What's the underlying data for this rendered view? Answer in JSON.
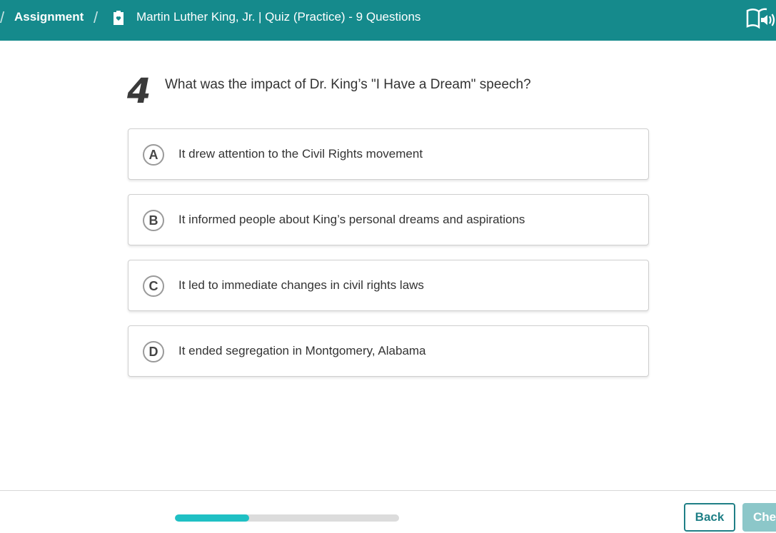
{
  "header": {
    "breadcrumb_root": "Assignment",
    "quiz_title": "Martin Luther King, Jr. | Quiz (Practice) - 9 Questions",
    "icons": [
      "quiz-bookmark-icon",
      "read-aloud-icon"
    ]
  },
  "question": {
    "number": "4",
    "text": "What was the impact of Dr. King’s \"I Have a Dream\" speech?",
    "options": [
      {
        "letter": "A",
        "text": "It drew attention to the Civil Rights movement"
      },
      {
        "letter": "B",
        "text": "It informed people about King’s personal dreams and aspirations"
      },
      {
        "letter": "C",
        "text": "It led to immediate changes in civil rights laws"
      },
      {
        "letter": "D",
        "text": "It ended segregation in Montgomery, Alabama"
      }
    ]
  },
  "footer": {
    "progress_fraction": 0.33,
    "back_label": "Back",
    "check_label": "Che"
  },
  "colors": {
    "header_bg": "#158a8c",
    "progress_fill": "#1fc0c4",
    "accent": "#1f7f86"
  }
}
